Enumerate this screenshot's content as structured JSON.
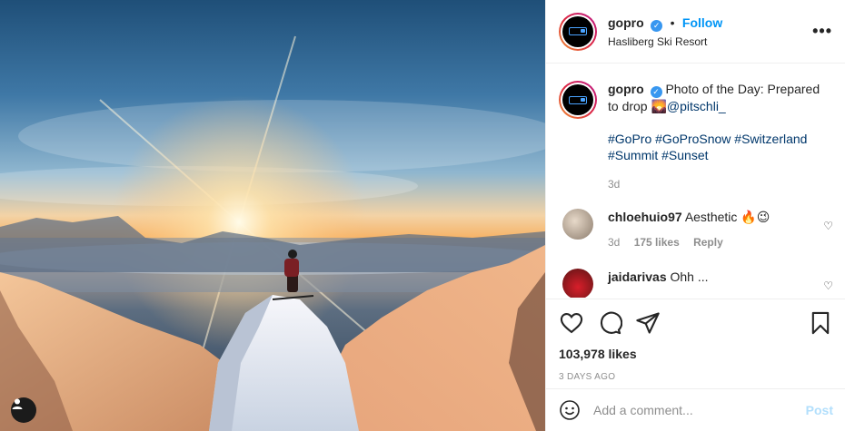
{
  "header": {
    "username": "gopro",
    "verified_icon": "verified-badge-icon",
    "separator": "•",
    "follow_label": "Follow",
    "location": "Hasliberg Ski Resort",
    "more_icon": "more-options-icon",
    "more_label": "•••"
  },
  "caption": {
    "username": "gopro",
    "text": "Photo of the Day: Prepared to drop",
    "emoji": "🌄",
    "mention": "@pitschli_",
    "hashtags": "#GoPro #GoProSnow #Switzerland #Summit #Sunset",
    "age": "3d"
  },
  "comments": [
    {
      "username": "chloehuio97",
      "text": "Aesthetic 🔥😉",
      "age": "3d",
      "likes": "175 likes",
      "reply_label": "Reply"
    },
    {
      "username": "jaidarivas",
      "text": "Ohh ...",
      "age": "",
      "likes": "",
      "reply_label": ""
    }
  ],
  "actions": {
    "like_icon": "heart-outline-icon",
    "comment_icon": "comment-bubble-icon",
    "share_icon": "paper-plane-icon",
    "save_icon": "bookmark-icon",
    "likes": "103,978 likes",
    "date": "3 DAYS AGO"
  },
  "add_comment": {
    "emoji_icon": "smiley-icon",
    "placeholder": "Add a comment...",
    "post_label": "Post"
  },
  "photo": {
    "tag_icon": "user-tag-icon"
  },
  "colors": {
    "link": "#0095f6",
    "hashtag": "#00376b",
    "muted": "#8e8e8e",
    "post_disabled": "#b2dffc"
  }
}
